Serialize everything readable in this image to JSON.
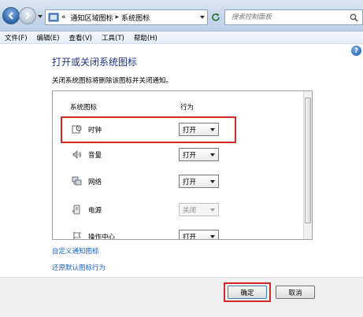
{
  "address_bar": {
    "crumbs": [
      "«",
      "通知区域图标",
      "系统图标"
    ],
    "search_placeholder": "搜索控制面板"
  },
  "menu": [
    "文件(F)",
    "编辑(E)",
    "查看(V)",
    "工具(T)",
    "帮助(H)"
  ],
  "help_glyph": "?",
  "content": {
    "title": "打开或关闭系统图标",
    "subtitle": "关闭系统图标将删除该图标并关闭通知。",
    "columns": {
      "icon": "系统图标",
      "behavior": "行为"
    },
    "rows": [
      {
        "name": "时钟",
        "value": "打开",
        "enabled": true,
        "icon": "clock-icon"
      },
      {
        "name": "音量",
        "value": "打开",
        "enabled": true,
        "icon": "volume-icon"
      },
      {
        "name": "网络",
        "value": "打开",
        "enabled": true,
        "icon": "network-icon"
      },
      {
        "name": "电源",
        "value": "关闭",
        "enabled": false,
        "icon": "power-icon"
      },
      {
        "name": "操作中心",
        "value": "打开",
        "enabled": true,
        "icon": "action-center-icon"
      }
    ],
    "links": {
      "customize": "自定义通知图标",
      "restore": "还原默认图标行为"
    }
  },
  "footer": {
    "ok": "确定",
    "cancel": "取消"
  },
  "colors": {
    "title": "#1e3287",
    "link": "#1463c8",
    "highlight": "#d62828"
  }
}
